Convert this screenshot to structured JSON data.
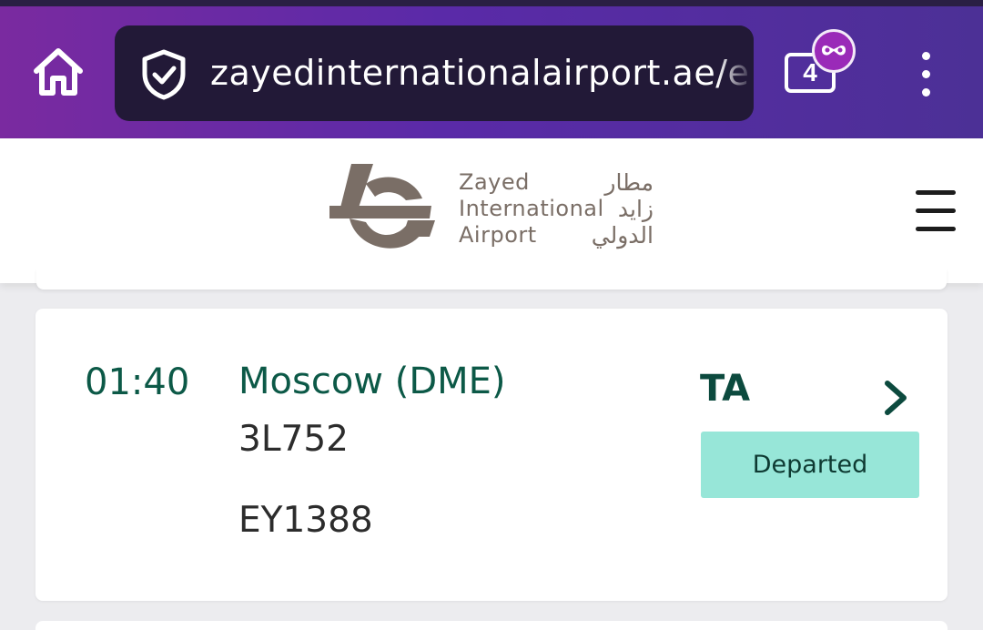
{
  "browser": {
    "url": "zayedinternationalairport.ae/en/Fl",
    "tab_count": "4",
    "icons": {
      "home": "home-icon",
      "security": "shield-check-icon",
      "incognito": "incognito-mask-icon",
      "menu": "more-vert-icon"
    }
  },
  "site": {
    "logo": {
      "en_lines": [
        "Zayed",
        "International",
        "Airport"
      ],
      "ar_lines": [
        "مطار",
        "زايد",
        "الدولي"
      ]
    },
    "menu_icon": "hamburger-icon"
  },
  "flight": {
    "time": "01:40",
    "destination": "Moscow (DME)",
    "flight_number": "3L752",
    "codeshare": "EY1388",
    "terminal": "TA",
    "status": "Departed"
  },
  "colors": {
    "brand_green": "#0c5947",
    "status_badge": "#97e6d8",
    "logo_brown": "#7a6e66",
    "browser_purple": "#6a2aa6"
  }
}
